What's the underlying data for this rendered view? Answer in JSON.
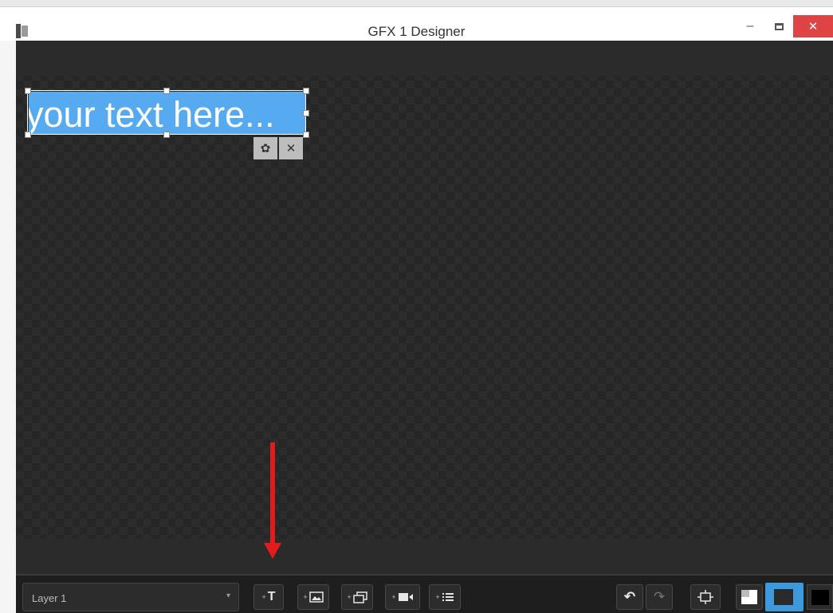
{
  "window": {
    "title": "GFX 1 Designer",
    "controls": {
      "minimize": "–",
      "close": "✕"
    }
  },
  "canvas": {
    "text_element": {
      "text": "your text here...",
      "highlight_color": "#55aaf0"
    },
    "element_actions": {
      "settings_icon": "gear-icon",
      "delete_icon": "close-icon",
      "delete_glyph": "✕",
      "settings_glyph": "✿"
    },
    "annotation": {
      "type": "arrow",
      "color": "#e31b1b",
      "points_to": "add-text-button"
    }
  },
  "toolbar": {
    "layer_select": {
      "value": "Layer 1",
      "caret": "▾"
    },
    "add_text": {
      "plus": "+",
      "glyph": "T"
    },
    "add_image": {
      "plus": "+",
      "icon": "image-icon"
    },
    "add_overlay": {
      "plus": "+",
      "icon": "layers-icon"
    },
    "add_video": {
      "plus": "+",
      "icon": "video-camera-icon"
    },
    "add_list": {
      "plus": "+",
      "icon": "list-icon"
    },
    "undo": {
      "glyph": "↶"
    },
    "redo": {
      "glyph": "↷"
    },
    "fit": {
      "icon": "fit-frame-icon"
    },
    "backgrounds": [
      "white-checker",
      "dark-checker",
      "black"
    ],
    "selected_background": "dark-checker",
    "accent": "#3b99dc"
  }
}
